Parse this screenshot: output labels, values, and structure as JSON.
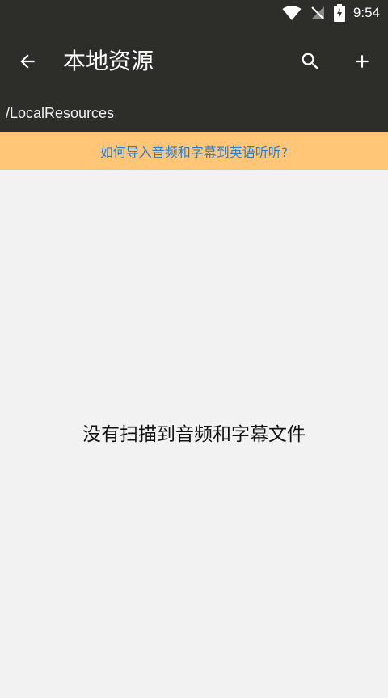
{
  "status_bar": {
    "time": "9:54",
    "icons": [
      "wifi-icon",
      "no-signal-icon",
      "battery-charging-icon"
    ]
  },
  "app_bar": {
    "title": "本地资源",
    "path": "/LocalResources",
    "icons": [
      "arrow-back-icon",
      "search-icon",
      "plus-icon"
    ]
  },
  "help_banner": {
    "text": "如何导入音频和字幕到英语听听?",
    "background": "#ffc677",
    "text_color": "#2a7fd0"
  },
  "main": {
    "empty_message": "没有扫描到音频和字幕文件"
  },
  "colors": {
    "toolbar": "#2d2e2a",
    "content_background": "#f2f2f2"
  }
}
